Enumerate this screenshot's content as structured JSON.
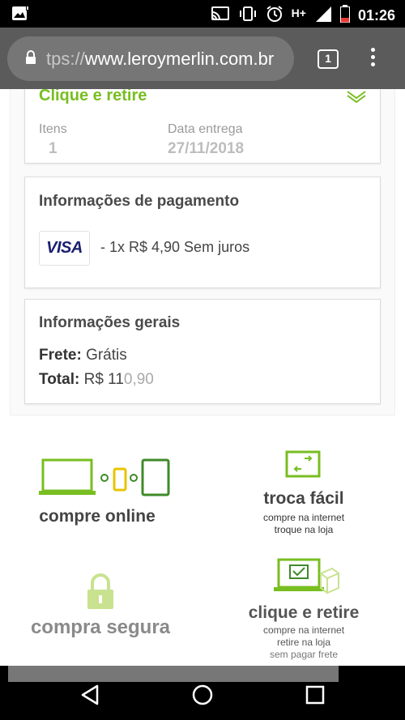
{
  "status_bar": {
    "network": "H+",
    "time": "01:26",
    "icons": [
      "image-notification-icon",
      "cast-icon",
      "vibrate-icon",
      "alarm-icon",
      "signal-icon",
      "battery-icon"
    ]
  },
  "browser": {
    "url_prefix": "tps://",
    "url_domain": "www.leroymerlin.com.br",
    "tab_count": "1"
  },
  "delivery_card": {
    "title": "Clique e retire",
    "items_label": "Itens",
    "items_value": "1",
    "date_label": "Data entrega",
    "date_value": "27/11/2018"
  },
  "payment_card": {
    "title": "Informações de pagamento",
    "card_brand": "VISA",
    "installments": "- 1x R$ 4,90 Sem juros"
  },
  "general_card": {
    "title": "Informações gerais",
    "shipping_label": "Frete:",
    "shipping_value": "Grátis",
    "total_label": "Total:",
    "total_value_main": "R$ 11",
    "total_value_faded": "0,90"
  },
  "features": {
    "online": {
      "title": "compre online"
    },
    "exchange": {
      "title": "troca fácil",
      "line1": "compre na internet",
      "line2": "troque na loja"
    },
    "secure": {
      "title": "compra segura"
    },
    "pickup": {
      "title": "clique e retire",
      "line1": "compre na internet",
      "line2": "retire na loja",
      "line3": "sem pagar frete"
    }
  },
  "colors": {
    "accent_green": "#78be20",
    "light_green": "#a8d86a",
    "dark_green": "#3f8a2a"
  }
}
